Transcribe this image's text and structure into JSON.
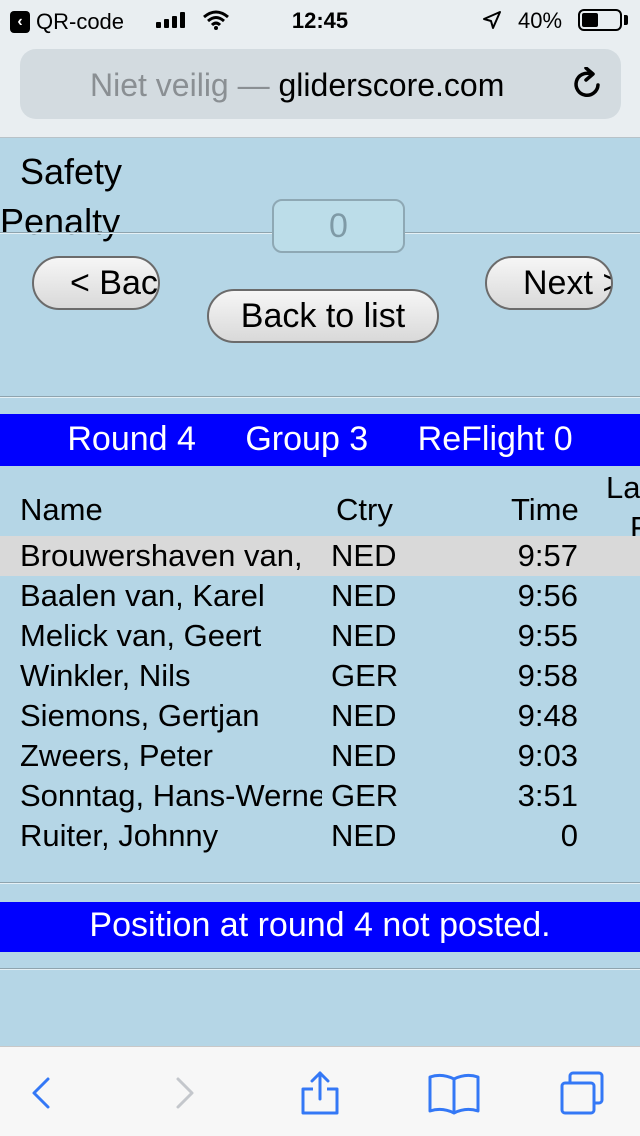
{
  "status_bar": {
    "back_app": "QR-code",
    "time": "12:45",
    "battery": "40%"
  },
  "browser": {
    "security": "Niet veilig —",
    "domain": "gliderscore.com"
  },
  "form": {
    "safety_label": "Safety",
    "penalty_label": "Penalty",
    "penalty_value": "0"
  },
  "nav": {
    "back_label": "< Back",
    "next_label": "Next >",
    "list_label": "Back to list"
  },
  "round_info": {
    "round": "Round 4",
    "group": "Group 3",
    "reflight": "ReFlight 0"
  },
  "table": {
    "headers": {
      "name": "Name",
      "ctry": "Ctry",
      "time": "Time",
      "extra_top": "La",
      "extra_bottom": "F"
    },
    "rows": [
      {
        "name": "Brouwershaven van,",
        "ctry": "NED",
        "time": "9:57"
      },
      {
        "name": "Baalen van, Karel",
        "ctry": "NED",
        "time": "9:56"
      },
      {
        "name": "Melick van, Geert",
        "ctry": "NED",
        "time": "9:55"
      },
      {
        "name": "Winkler, Nils",
        "ctry": "GER",
        "time": "9:58"
      },
      {
        "name": "Siemons, Gertjan",
        "ctry": "NED",
        "time": "9:48"
      },
      {
        "name": "Zweers, Peter",
        "ctry": "NED",
        "time": "9:03"
      },
      {
        "name": "Sonntag, Hans-Werner",
        "ctry": "GER",
        "time": "3:51"
      },
      {
        "name": "Ruiter, Johnny",
        "ctry": "NED",
        "time": "0"
      }
    ]
  },
  "position_message": "Position at round 4 not posted.",
  "colors": {
    "page_bg": "#b5d6e6",
    "bar_blue": "#0000ff",
    "selected_row": "#d9d9d9",
    "ios_blue": "#3478f6"
  }
}
